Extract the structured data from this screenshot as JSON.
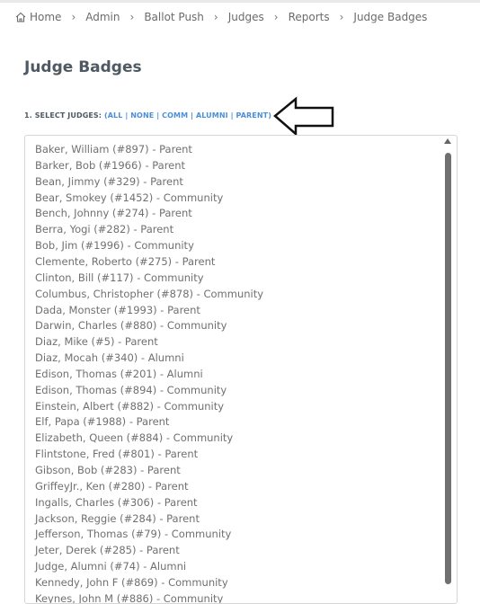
{
  "breadcrumb": [
    "Home",
    "Admin",
    "Ballot Push",
    "Judges",
    "Reports",
    "Judge Badges"
  ],
  "page": {
    "title": "Judge Badges"
  },
  "select": {
    "prefix": "1. SELECT JUDGES:",
    "open": "(",
    "close": ")",
    "sep": "|",
    "links": [
      "ALL",
      "NONE",
      "COMM",
      "ALUMNI",
      "PARENT"
    ]
  },
  "judges": [
    "Baker, William (#897) - Parent",
    "Barker, Bob (#1966) - Parent",
    "Bean, Jimmy (#329) - Parent",
    "Bear, Smokey (#1452) - Community",
    "Bench, Johnny (#274) - Parent",
    "Berra, Yogi (#282) - Parent",
    "Bob, Jim (#1996) - Community",
    "Clemente, Roberto (#275) - Parent",
    "Clinton, Bill (#117) - Community",
    "Columbus, Christopher (#878) - Community",
    "Dada, Monster (#1993) - Parent",
    "Darwin, Charles (#880) - Community",
    "Diaz, Mike (#5) - Parent",
    "Diaz, Mocah (#340) - Alumni",
    "Edison, Thomas (#201) - Alumni",
    "Edison, Thomas (#894) - Community",
    "Einstein, Albert (#882) - Community",
    "Elf, Papa (#1988) - Parent",
    "Elizabeth, Queen (#884) - Community",
    "Flintstone, Fred (#801) - Parent",
    "Gibson, Bob (#283) - Parent",
    "GriffeyJr., Ken (#280) - Parent",
    "Ingalls, Charles (#306) - Parent",
    "Jackson, Reggie (#284) - Parent",
    "Jefferson, Thomas (#79) - Community",
    "Jeter, Derek (#285) - Parent",
    "Judge, Alumni (#74) - Alumni",
    "Kennedy, John F (#869) - Community",
    "Keynes, John M (#886) - Community"
  ]
}
